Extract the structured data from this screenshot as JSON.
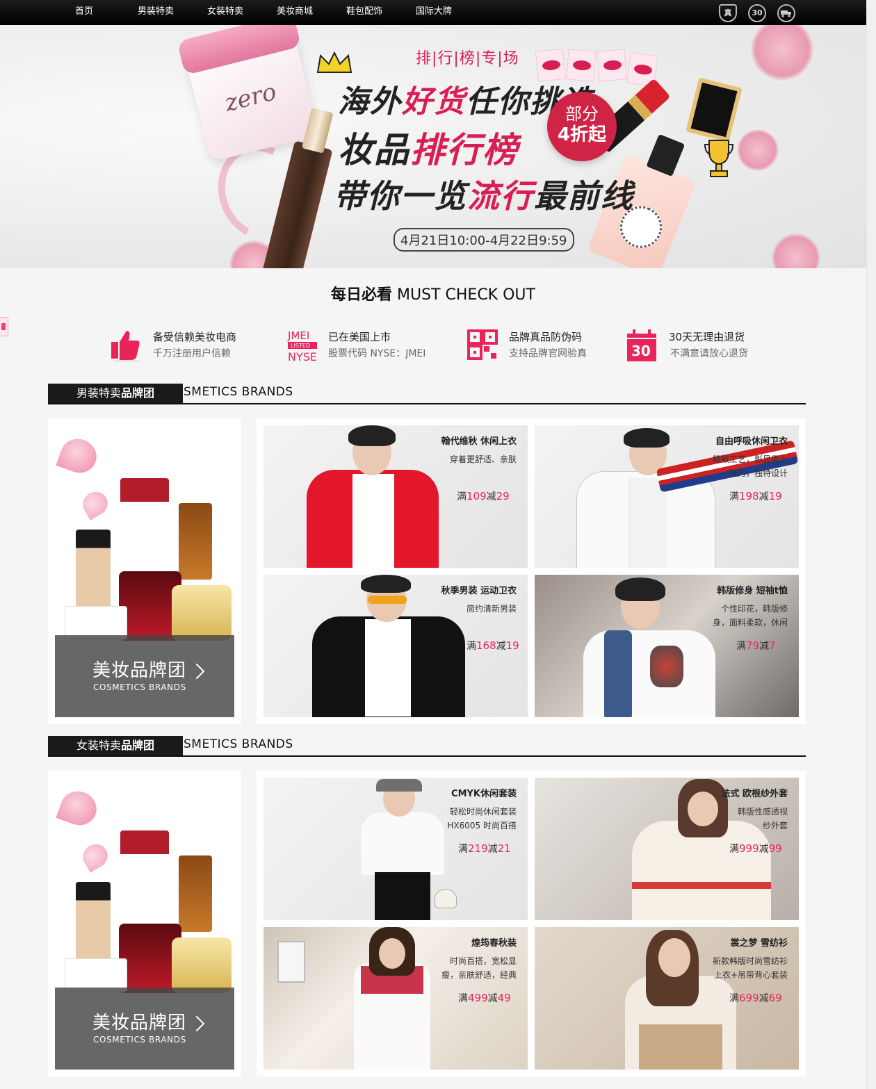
{
  "nav": {
    "items": [
      "首页",
      "男装特卖",
      "女装特卖",
      "美妆商城",
      "鞋包配饰",
      "国际大牌"
    ],
    "badges": [
      "真",
      "30",
      "运"
    ]
  },
  "banner": {
    "line1": "排|行|榜|专|场",
    "line2a": "海外",
    "line2b": "好货",
    "line2c": "任你挑选",
    "line3a": "妆品",
    "line3b": "排行榜",
    "line4a": "带你一览",
    "line4b": "流行",
    "line4c": "最前线",
    "circle_top": "部分",
    "circle_bottom": "4折起",
    "date": "4月21日10:00-4月22日9:59",
    "jar_text": "zero"
  },
  "mustcheck": {
    "cn": "每日必看",
    "en": "MUST CHECK OUT"
  },
  "features": [
    {
      "title": "备受信赖美妆电商",
      "sub": "千万注册用户信赖",
      "icon": "thumbs-up-icon"
    },
    {
      "title": "已在美国上市",
      "sub": "股票代码 NYSE：JMEI",
      "icon": "jmei-nyse-icon",
      "icon_text": [
        "JMEI",
        "LISTED",
        "NYSE"
      ]
    },
    {
      "title": "品牌真品防伪码",
      "sub": "支持品牌官网验真",
      "icon": "qr-code-icon"
    },
    {
      "title": "30天无理由退货",
      "sub": "不满意请放心退货",
      "icon": "calendar-30-icon",
      "icon_text": "30"
    }
  ],
  "sections": [
    {
      "tag_light": "男装特卖",
      "tag_bold": "品牌团",
      "en": "SMETICS BRANDS",
      "brand": {
        "cn": "美妆品牌团",
        "en": "COSMETICS  BRANDS"
      },
      "products": [
        {
          "title": "翰代维秋 休闲上衣",
          "desc": [
            "穿着更舒适、亲肤"
          ],
          "price_pre": "满",
          "price_a": "109",
          "price_mid": "减",
          "price_b": "29"
        },
        {
          "title": "自由呼吸休闲卫衣",
          "desc": [
            "精致工艺，彰显男士",
            "魅力，独特设计"
          ],
          "price_pre": "满",
          "price_a": "198",
          "price_mid": "减",
          "price_b": "19"
        },
        {
          "title": "秋季男装 运动卫衣",
          "desc": [
            "简约清新男装"
          ],
          "price_pre": "满",
          "price_a": "168",
          "price_mid": "减",
          "price_b": "19"
        },
        {
          "title": "韩版修身 短袖t恤",
          "desc": [
            "个性印花，韩版修",
            "身，面料柔软，休闲"
          ],
          "price_pre": "满",
          "price_a": "79",
          "price_mid": "减",
          "price_b": "7"
        }
      ]
    },
    {
      "tag_light": "女装特卖",
      "tag_bold": "品牌团",
      "en": "SMETICS BRANDS",
      "brand": {
        "cn": "美妆品牌团",
        "en": "COSMETICS  BRANDS"
      },
      "products": [
        {
          "title": "CMYK休闲套装",
          "desc": [
            "轻松时尚休闲套装",
            "HX6005 时尚百搭"
          ],
          "price_pre": "满",
          "price_a": "219",
          "price_mid": "减",
          "price_b": "21"
        },
        {
          "title": "法式 欧根纱外套",
          "desc": [
            "韩版性感透视",
            "纱外套"
          ],
          "price_pre": "满",
          "price_a": "999",
          "price_mid": "减",
          "price_b": "99"
        },
        {
          "title": "煌筠春秋装",
          "desc": [
            "时尚百搭，宽松显",
            "瘦，亲肤舒适，经典"
          ],
          "price_pre": "满",
          "price_a": "499",
          "price_mid": "减",
          "price_b": "49"
        },
        {
          "title": "裳之梦 雪纺衫",
          "desc": [
            "新款韩版时尚雪纺衫",
            "上衣+吊带背心套装"
          ],
          "price_pre": "满",
          "price_a": "699",
          "price_mid": "减",
          "price_b": "69"
        }
      ]
    }
  ],
  "colors": {
    "accent": "#e8245b",
    "dark": "#1a1a1a",
    "banner_red": "#d81f53"
  }
}
